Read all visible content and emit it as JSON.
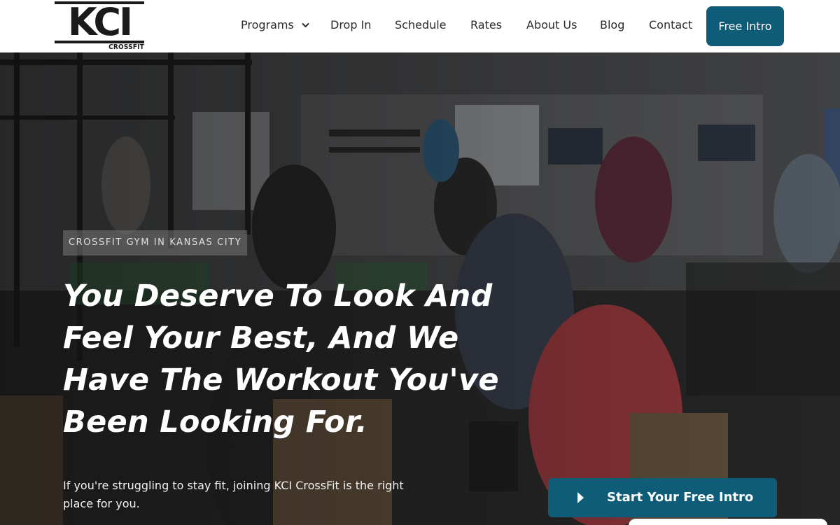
{
  "brand": {
    "logo_main": "KCI",
    "logo_sub": "CROSSFIT"
  },
  "nav": {
    "items": [
      {
        "label": "Programs",
        "has_dropdown": true
      },
      {
        "label": "Drop In"
      },
      {
        "label": "Schedule"
      },
      {
        "label": "Rates"
      },
      {
        "label": "About Us"
      },
      {
        "label": "Blog"
      },
      {
        "label": "Contact"
      }
    ],
    "cta_label": "Free Intro"
  },
  "hero": {
    "eyebrow": "CROSSFIT GYM IN KANSAS CITY",
    "headline": "You Deserve To Look And Feel Your Best, And We Have The Workout You've Been Looking For.",
    "subtext": "If you're struggling to stay fit, joining KCI CrossFit is the right place for you.",
    "cta_label": "Start Your Free Intro",
    "cta_icon": "play-icon"
  },
  "colors": {
    "accent": "#0f5c78",
    "nav_text": "#2a2a2a",
    "hero_text": "#ffffff"
  }
}
